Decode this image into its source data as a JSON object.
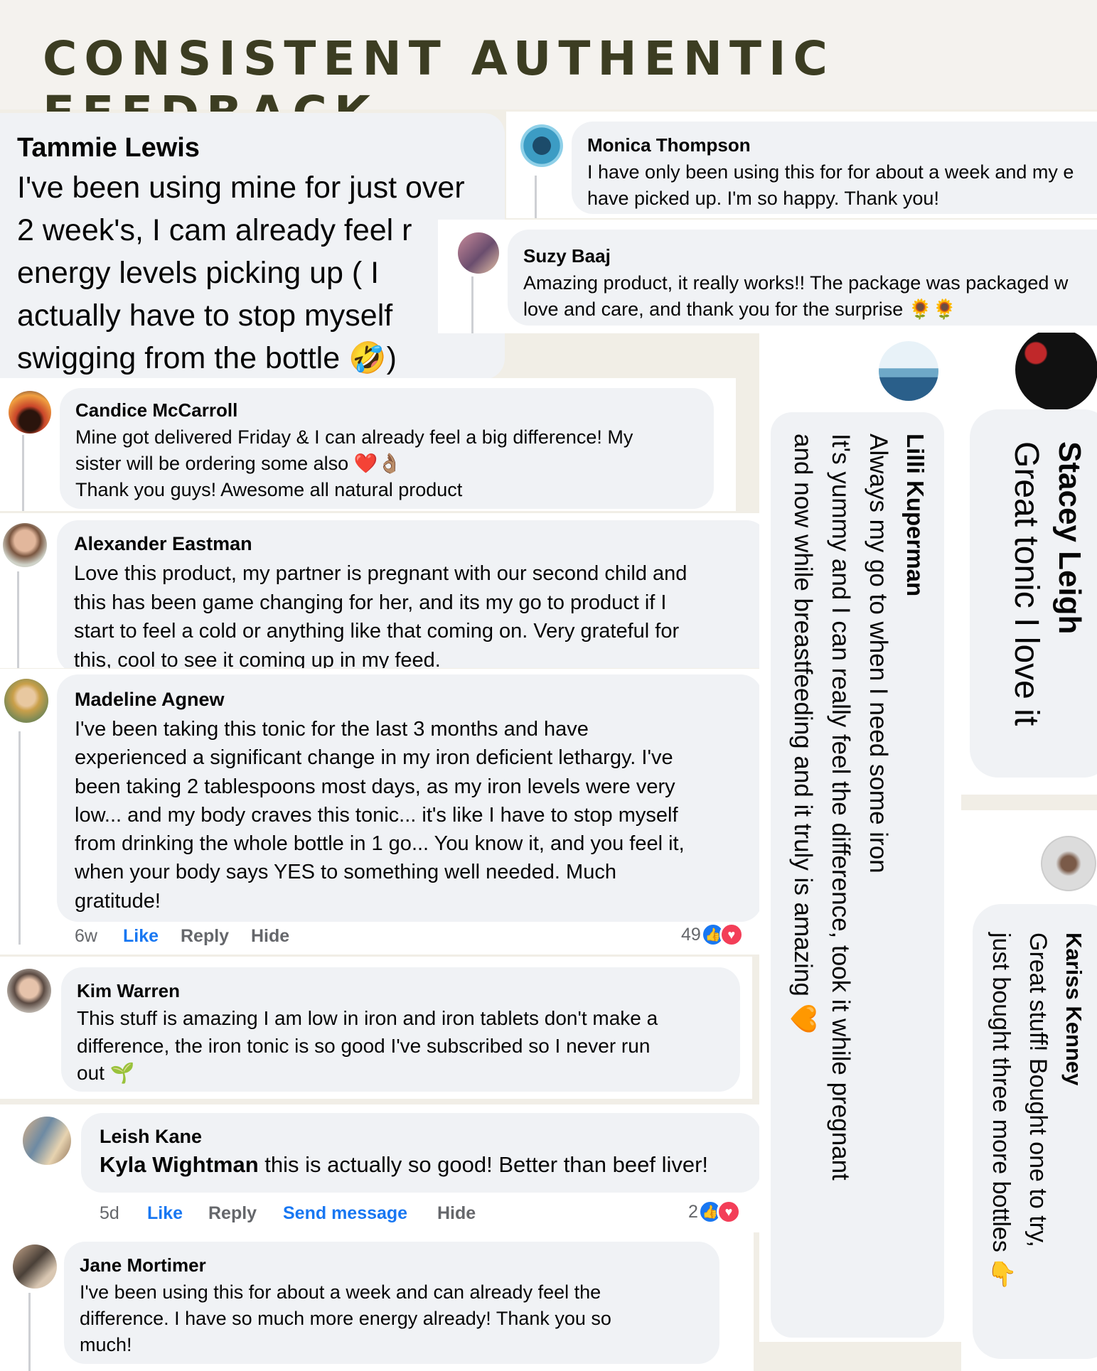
{
  "header": {
    "title": "CONSISTENT AUTHENTIC FEEDBACK"
  },
  "colors": {
    "title": "#3c3d22",
    "bubble": "#f0f2f5",
    "link": "#1877f2",
    "meta": "#65676b",
    "love": "#f33e58"
  },
  "comments": {
    "tammie": {
      "name": "Tammie Lewis",
      "text": "I've been using mine for just over\n2 week's, I cam already feel r\nenergy levels picking up ( I\nactually have to stop myself\nswigging from the bottle 🤣)"
    },
    "monica": {
      "name": "Monica Thompson",
      "text": "I have only been using this for for about a week and my e\nhave picked up. I'm so happy. Thank you!"
    },
    "suzy": {
      "name": "Suzy Baaj",
      "text": "Amazing product, it really works!! The package was packaged w\nlove and care, and thank you for the surprise 🌻🌻"
    },
    "candice": {
      "name": "Candice McCarroll",
      "text": "Mine got delivered Friday & I can already feel a big difference! My\nsister will be ordering some also ❤️👌🏽\nThank you guys! Awesome all natural product"
    },
    "alexander": {
      "name": "Alexander Eastman",
      "text": "Love this product, my partner is pregnant with our second child and\nthis has been game changing for her, and its my go to product if I\nstart to feel a cold or anything like that coming on. Very grateful for\nthis, cool to see it coming up in my feed."
    },
    "madeline": {
      "name": "Madeline Agnew",
      "text": "I've been taking this tonic for the last 3 months and have\nexperienced a significant change in my iron deficient lethargy. I've\nbeen taking 2 tablespoons most days, as my iron levels were very\nlow... and my body craves this tonic... it's like I have to stop myself\nfrom drinking the whole bottle in 1 go... You know it, and you feel it,\nwhen your body says YES to something well needed. Much\ngratitude!",
      "time": "6w",
      "like": "Like",
      "reply": "Reply",
      "hide": "Hide",
      "count": "49"
    },
    "kim": {
      "name": "Kim Warren",
      "text": "This stuff is amazing I am low in iron and iron tablets don't make a\ndifference, the iron tonic is so good I've subscribed so I never run\nout 🌱"
    },
    "leish": {
      "name": "Leish Kane",
      "mention": "Kyla Wightman",
      "text": " this is actually so good! Better than beef liver!",
      "time": "5d",
      "like": "Like",
      "reply": "Reply",
      "send": "Send message",
      "hide": "Hide",
      "count": "2"
    },
    "jane": {
      "name": "Jane Mortimer",
      "text": "I've been using this for about a week and can already feel the\ndifference. I have so much more energy already! Thank you so\nmuch!"
    },
    "lilli": {
      "name": "Lilli Kuperman",
      "text": "Always my go to when I need some iron\nIt's yummy and I can really feel the difference, took it while pregnant\nand now while breastfeeding and it truly is amazing 🧡"
    },
    "stacey": {
      "name": "Stacey Leigh",
      "text": "Great tonic I love it"
    },
    "kariss": {
      "name": "Kariss Kenney",
      "text": "Great stuff! Bought one to try,\njust bought three more bottles 👉"
    }
  }
}
